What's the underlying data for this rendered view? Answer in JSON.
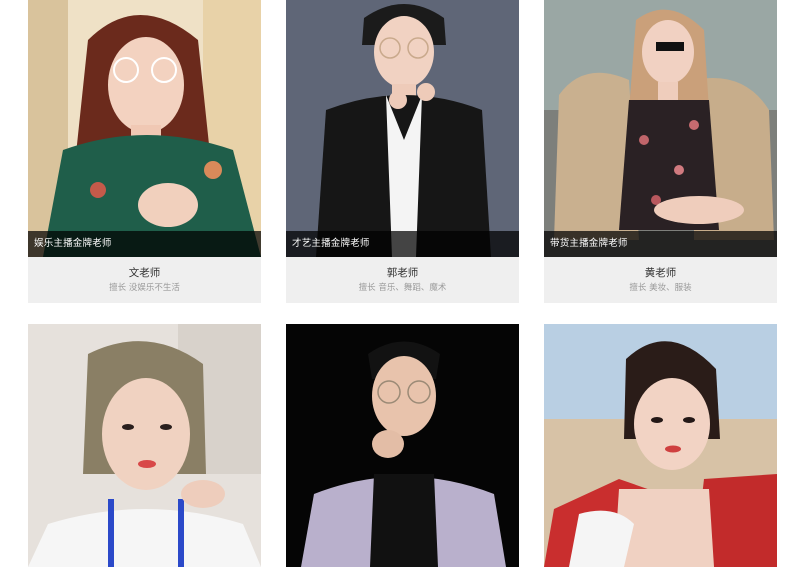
{
  "teachers": [
    {
      "tag": "娱乐主播金牌老师",
      "name": "文老师",
      "desc": "擅长 没娱乐不生活"
    },
    {
      "tag": "才艺主播金牌老师",
      "name": "郭老师",
      "desc": "擅长 音乐、舞蹈、魔术"
    },
    {
      "tag": "带货主播金牌老师",
      "name": "黄老师",
      "desc": "擅长 美妆、服装"
    },
    {
      "tag": "",
      "name": "",
      "desc": ""
    },
    {
      "tag": "",
      "name": "",
      "desc": ""
    },
    {
      "tag": "",
      "name": "",
      "desc": ""
    }
  ],
  "colors": {
    "tag_overlay": "#000000",
    "info_bg": "#efefef",
    "name_text": "#333333",
    "desc_text": "#9a9a9a"
  }
}
